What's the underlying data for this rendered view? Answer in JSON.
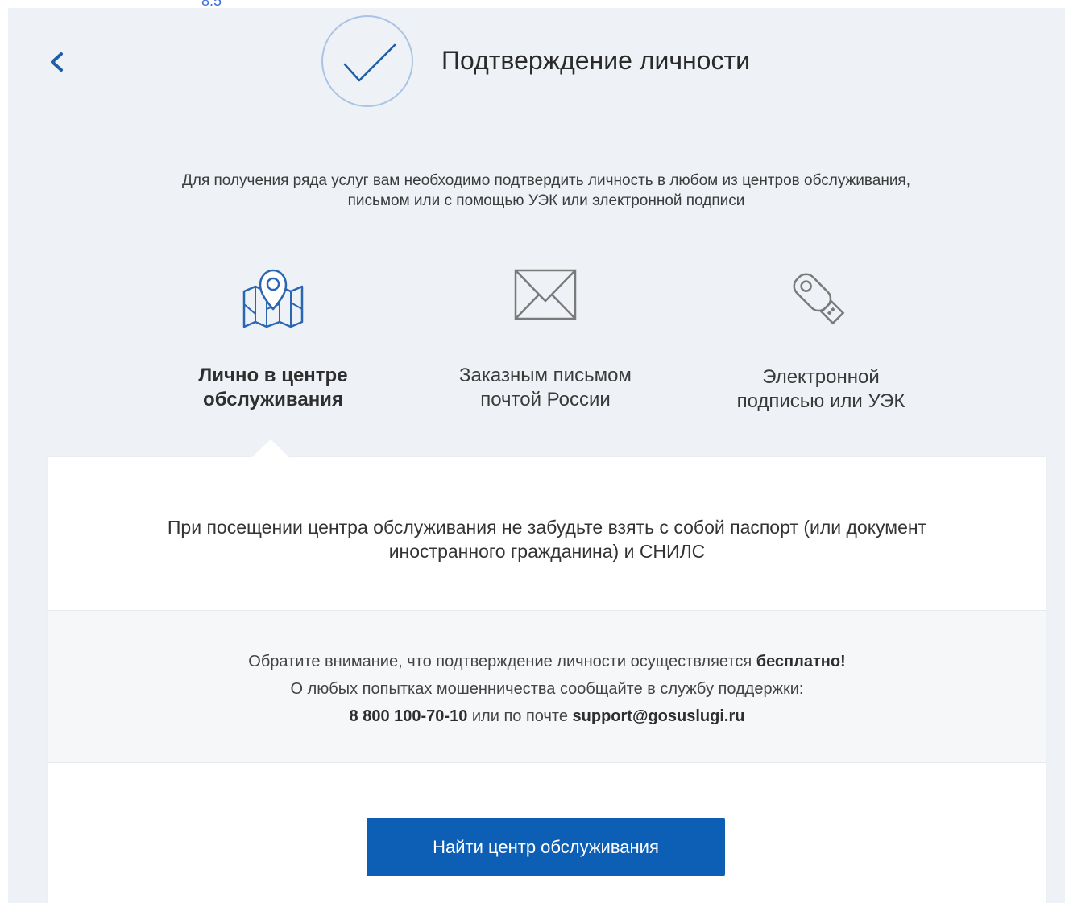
{
  "corner_label": "8.5",
  "header": {
    "title": "Подтверждение личности"
  },
  "intro": {
    "line1": "Для получения ряда услуг вам необходимо подтвердить личность в любом из центров обслуживания,",
    "line2": "письмом или с помощью УЭК или электронной подписи"
  },
  "options": [
    {
      "icon": "map-pin-icon",
      "line1": "Лично в центре",
      "line2": "обслуживания",
      "selected": true
    },
    {
      "icon": "envelope-icon",
      "line1": "Заказным письмом",
      "line2": "почтой России",
      "selected": false
    },
    {
      "icon": "usb-key-icon",
      "line1": "Электронной",
      "line2": "подписью или УЭК",
      "selected": false
    }
  ],
  "card": {
    "line1": "При посещении центра обслуживания не забудьте взять с собой паспорт (или документ",
    "line2": "иностранного гражданина) и СНИЛС"
  },
  "notice": {
    "line1_text": "Обратите внимание, что подтверждение личности осуществляется ",
    "line1_bold": "бесплатно!",
    "line2": "О любых попытках мошенничества сообщайте в службу поддержки:",
    "phone": "8 800 100-70-10",
    "line3_mid": " или по почте ",
    "email": "support@gosuslugi.ru"
  },
  "button": {
    "label": "Найти центр обслуживания"
  },
  "colors": {
    "accent": "#0d5fb5",
    "panel_bg": "#eef2f6",
    "check_circle": "#a9c4e6",
    "check_mark": "#1e5da8",
    "icon_blue": "#2b66b0",
    "icon_gray": "#7a7a7a"
  }
}
